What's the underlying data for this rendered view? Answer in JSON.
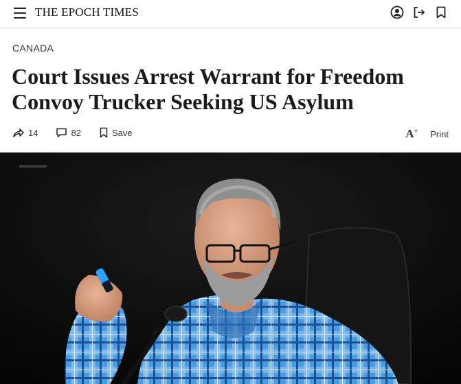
{
  "header": {
    "brand": "THE EPOCH TIMES",
    "icons": [
      "menu-icon",
      "account-icon",
      "login-icon",
      "bookmark-icon"
    ]
  },
  "article": {
    "section": "CANADA",
    "title": "Court Issues Arrest Warrant for Freedom Convoy Trucker Seeking US Asylum",
    "share_count": "14",
    "comment_count": "82",
    "save_label": "Save",
    "font_size_label": "A",
    "print_label": "Print"
  },
  "photo": {
    "description_icon": "news-photo",
    "colors": {
      "background": "#0a0a0a",
      "shirt": "#3b8fd8",
      "hair": "#9a9a9a"
    }
  }
}
